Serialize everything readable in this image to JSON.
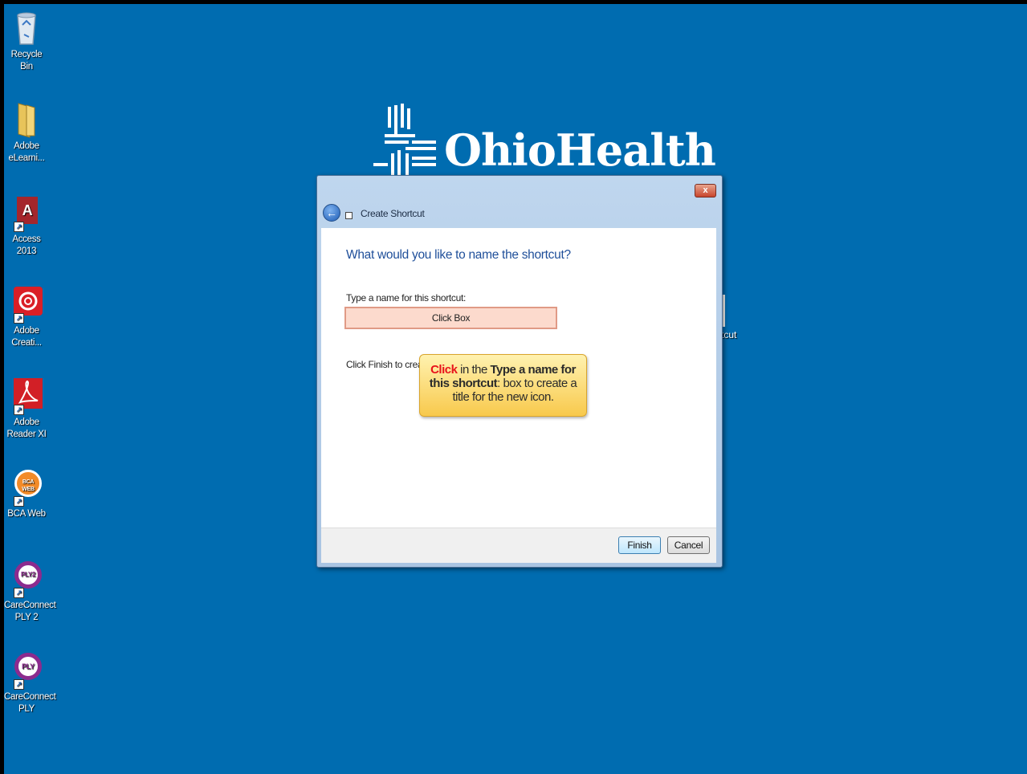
{
  "desktop_icons": [
    {
      "name": "recycle-bin",
      "label": "Recycle Bin"
    },
    {
      "name": "adobe-elearning",
      "label": "Adobe eLearni..."
    },
    {
      "name": "access-2013",
      "label": "Access 2013"
    },
    {
      "name": "adobe-creative",
      "label": "Adobe Creati..."
    },
    {
      "name": "adobe-reader",
      "label": "Adobe Reader XI"
    },
    {
      "name": "bca-web",
      "label": "BCA Web"
    },
    {
      "name": "careconnect-ply2",
      "label": "CareConnect PLY 2"
    },
    {
      "name": "careconnect-ply",
      "label": "CareConnect PLY"
    }
  ],
  "icon_glyphs": {
    "access": "A",
    "bca": "BCA WEB",
    "ply2": "PLY2",
    "ply": "PLY"
  },
  "logo": {
    "text": "OhioHealth"
  },
  "behind_window_label": "tcut",
  "dialog": {
    "title": "Create Shortcut",
    "close_glyph": "x",
    "heading": "What would you like to name the shortcut?",
    "field_label": "Type a name for this shortcut:",
    "field_value": "Click Box",
    "finish_hint": "Click Finish to create t",
    "finish_label": "Finish",
    "cancel_label": "Cancel"
  },
  "callout": {
    "part1": "Click",
    "part2": " in the ",
    "part3": "Type a name for this shortcut",
    "part4": ": box to create a title for the new icon."
  },
  "colors": {
    "desktop": "#006cb0",
    "heading": "#1f4f9a",
    "callout_red": "#e8131b"
  }
}
